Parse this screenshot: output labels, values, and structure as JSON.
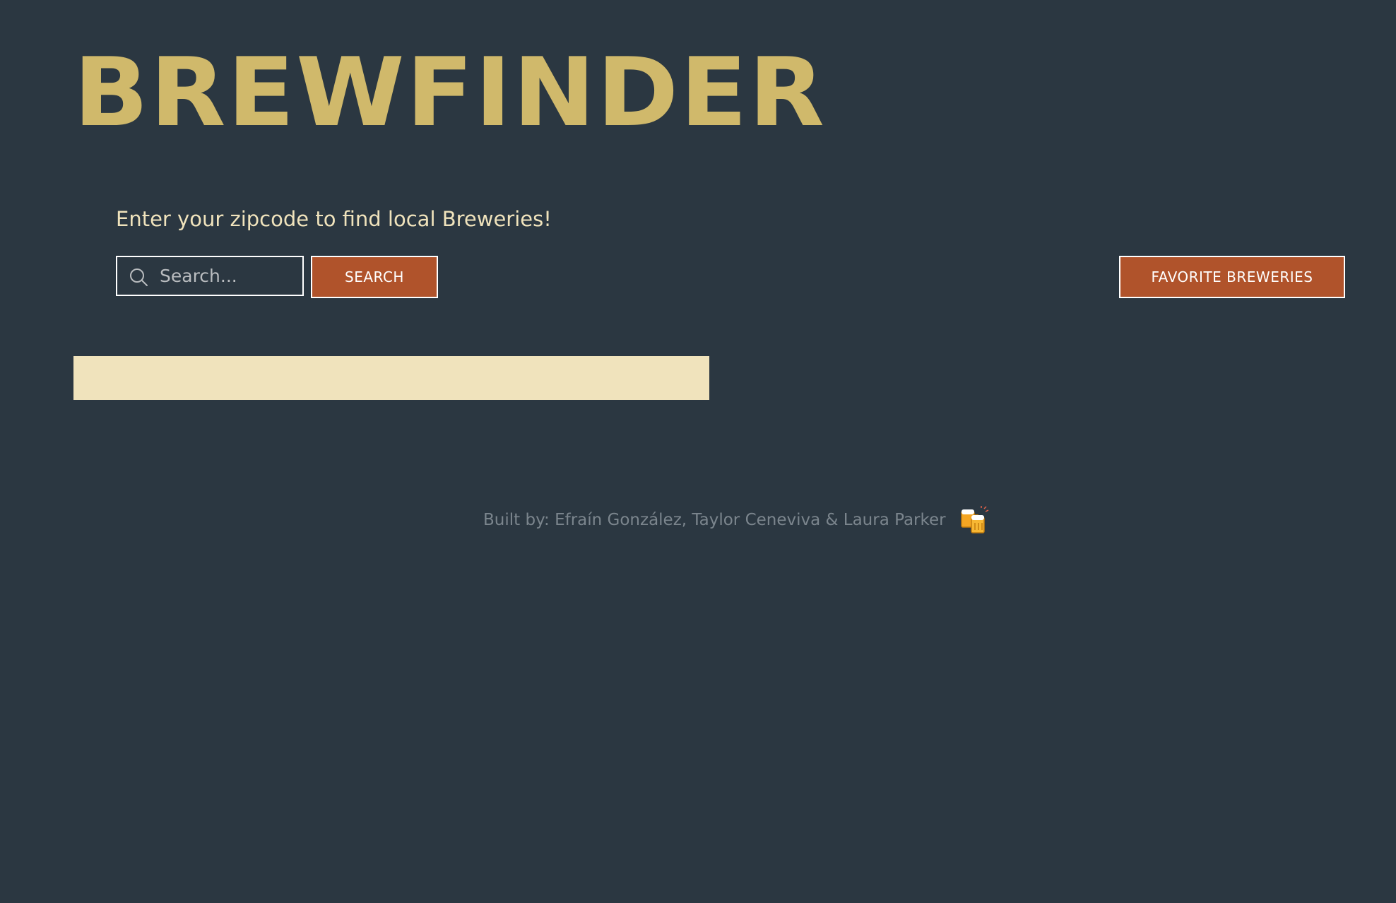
{
  "header": {
    "logo_text": "BREWFINDER"
  },
  "search": {
    "prompt": "Enter your zipcode to find local Breweries!",
    "placeholder": "Search...",
    "value": "",
    "button_label": "SEARCH"
  },
  "favorites": {
    "button_label": "FAVORITE BREWERIES"
  },
  "footer": {
    "credits": "Built by: Efraín González, Taylor Ceneviva & Laura Parker",
    "icon": "beer-mugs-icon"
  },
  "colors": {
    "background": "#2b3741",
    "logo": "#d0b96b",
    "cream": "#f0e3bc",
    "button": "#b0532b",
    "footer_text": "#7b858d"
  }
}
